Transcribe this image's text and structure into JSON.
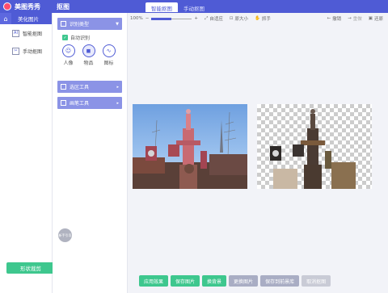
{
  "topbar": {
    "app_title": "美图秀秀",
    "section_title": "抠图",
    "tabs": [
      {
        "label": "智能抠图",
        "active": true
      },
      {
        "label": "手动抠图",
        "active": false
      }
    ]
  },
  "leftnav": {
    "header": "美化图片",
    "items": [
      {
        "label": "智能抠图",
        "icon": "AI"
      },
      {
        "label": "手动抠图",
        "icon": "hand-cut-icon"
      }
    ],
    "shape_button": "形状裁剪"
  },
  "toolpanel": {
    "recognize": {
      "title": "识别类型",
      "auto_label": "自动识别",
      "types": [
        {
          "label": "人像",
          "icon": "person-icon",
          "active": false
        },
        {
          "label": "物品",
          "icon": "object-icon",
          "active": true
        },
        {
          "label": "图标",
          "icon": "graphic-icon",
          "active": false
        }
      ]
    },
    "select_tool": "选区工具",
    "brush_tool": "画笔工具",
    "avatar_text": "新手引导"
  },
  "toolbar": {
    "zoom": "100%",
    "zoom_level": 0.5,
    "fit": "自适应",
    "original": "原大小",
    "hand": "抓手",
    "undo": "撤销",
    "redo": "重做",
    "restore": "还原"
  },
  "actions": [
    {
      "label": "应用效果",
      "style": "green"
    },
    {
      "label": "保存图片",
      "style": "green"
    },
    {
      "label": "换背景",
      "style": "green"
    },
    {
      "label": "更换图片",
      "style": "gray"
    },
    {
      "label": "保存到前景库",
      "style": "gray"
    },
    {
      "label": "取消抠图",
      "style": "light"
    }
  ],
  "colors": {
    "brand": "#4f5bd5",
    "green": "#3ec78e"
  }
}
